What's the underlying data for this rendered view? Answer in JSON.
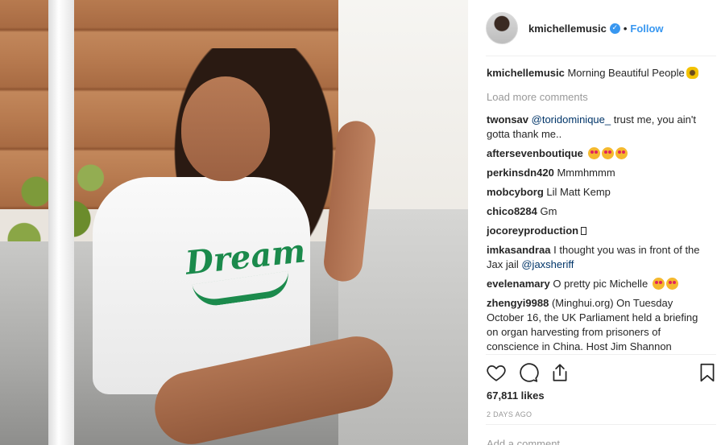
{
  "post": {
    "username": "kmichellemusic",
    "verified_icon": "verified-badge-icon",
    "dot": "•",
    "follow_label": "Follow",
    "caption": {
      "user": "kmichellemusic",
      "text": "Morning Beautiful People",
      "emoji": "sunflower"
    },
    "load_more": "Load more comments",
    "likes": "67,811 likes",
    "time": "2 DAYS AGO",
    "add_comment_placeholder": "Add a comment..."
  },
  "photo": {
    "shirt_text": "Dream"
  },
  "comments": [
    {
      "user": "twonsav",
      "mention": "@toridominique_",
      "text": " trust me, you ain't gotta thank me.."
    },
    {
      "user": "aftersevenboutique",
      "text": "",
      "emoji": [
        "heart-eyes",
        "heart-eyes",
        "heart-eyes"
      ]
    },
    {
      "user": "perkinsdn420",
      "text": "Mmmhmmm"
    },
    {
      "user": "mobcyborg",
      "text": "Lil Matt Kemp"
    },
    {
      "user": "chico8284",
      "text": "Gm"
    },
    {
      "user": "jocoreyproduction",
      "text": "",
      "glyph": "unknown-glyph"
    },
    {
      "user": "imkasandraa",
      "text": "I thought you was in front of the Jax jail ",
      "mention": "@jaxsheriff"
    },
    {
      "user": "evelenamary",
      "text": "O pretty pic Michelle ",
      "emoji": [
        "heart-eyes",
        "heart-eyes"
      ]
    },
    {
      "user": "zhengyi9988",
      "text": "(Minghui.org) On Tuesday October 16, the UK Parliament held a briefing on organ harvesting from prisoners of conscience in China. Host Jim Shannon"
    }
  ],
  "icons": {
    "like": "heart-icon",
    "comment": "comment-icon",
    "share": "share-icon",
    "save": "bookmark-icon"
  },
  "colors": {
    "accent": "#3897f0",
    "mention": "#003569",
    "muted": "#999999",
    "shirt_print": "#1b8a4c"
  }
}
